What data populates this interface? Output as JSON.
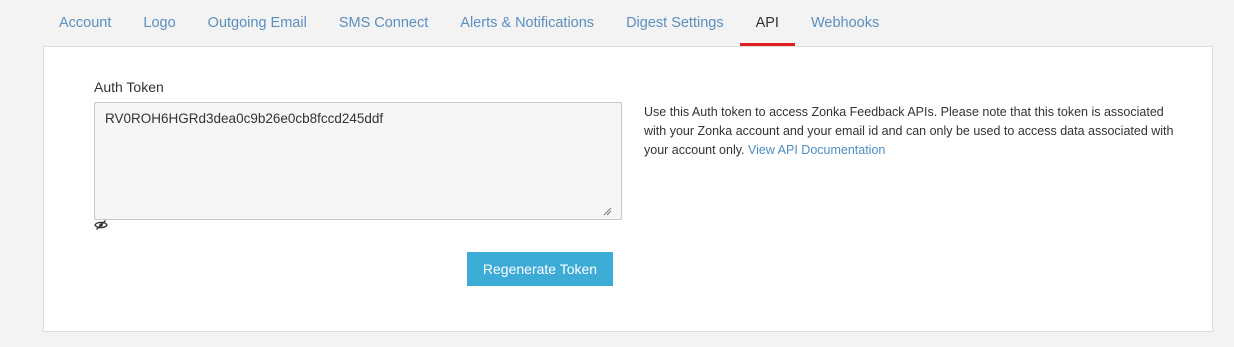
{
  "tabs": [
    {
      "label": "Account"
    },
    {
      "label": "Logo"
    },
    {
      "label": "Outgoing Email"
    },
    {
      "label": "SMS Connect"
    },
    {
      "label": "Alerts & Notifications"
    },
    {
      "label": "Digest Settings"
    },
    {
      "label": "API",
      "active": true
    },
    {
      "label": "Webhooks"
    }
  ],
  "api": {
    "auth_token_label": "Auth Token",
    "auth_token_value": "RV0ROH6HGRd3dea0c9b26e0cb8fccd245ddf",
    "regenerate_label": "Regenerate Token",
    "help_text": "Use this Auth token to access Zonka Feedback APIs. Please note that this token is associated with your Zonka account and your email id and can only be used to access data associated with your account only.",
    "doc_link_label": "View API Documentation"
  },
  "icons": {
    "toggle_visibility": "eye-slash-icon"
  },
  "colors": {
    "tab_link": "#5b8fbd",
    "active_tab_underline": "#e02020",
    "button_bg": "#3cabd6",
    "link": "#4a8ec2"
  }
}
